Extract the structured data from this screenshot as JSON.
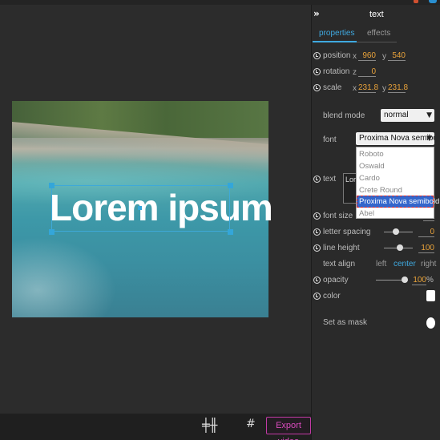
{
  "canvas": {
    "text": "Lorem ipsum"
  },
  "bottom": {
    "export_label": "Export video",
    "align_icon": "align-icon",
    "grid_icon": "grid-icon"
  },
  "panel": {
    "collapse": "»",
    "title": "text",
    "tabs": {
      "properties": "properties",
      "effects": "effects"
    },
    "position": {
      "label": "position",
      "x_axis": "x",
      "x": "960",
      "y_axis": "y",
      "y": "540"
    },
    "rotation": {
      "label": "rotation",
      "z_axis": "z",
      "z": "0"
    },
    "scale": {
      "label": "scale",
      "x_axis": "x",
      "x": "231.8",
      "y_axis": "y",
      "y": "231.8"
    },
    "blend_mode": {
      "label": "blend mode",
      "value": "normal"
    },
    "font": {
      "label": "font",
      "value": "Proxima Nova semibold",
      "options": [
        "Roboto",
        "Oswald",
        "Cardo",
        "Crete Round",
        "Proxima Nova semibold",
        "Abel"
      ]
    },
    "text": {
      "label": "text",
      "value": "Lore"
    },
    "font_size": {
      "label": "font size"
    },
    "letter_spacing": {
      "label": "letter spacing",
      "value": "0"
    },
    "line_height": {
      "label": "line height",
      "value": "100"
    },
    "text_align": {
      "label": "text align",
      "left": "left",
      "center": "center",
      "right": "right",
      "selected": "center"
    },
    "opacity": {
      "label": "opacity",
      "value": "100",
      "unit": "%"
    },
    "color": {
      "label": "color",
      "value": "#ffffff"
    },
    "mask": {
      "label": "Set as mask"
    }
  },
  "colors": {
    "accent": "#3fa9e0",
    "value": "#e8a23a",
    "export": "#d94bbd",
    "selection": "#3366cc"
  }
}
